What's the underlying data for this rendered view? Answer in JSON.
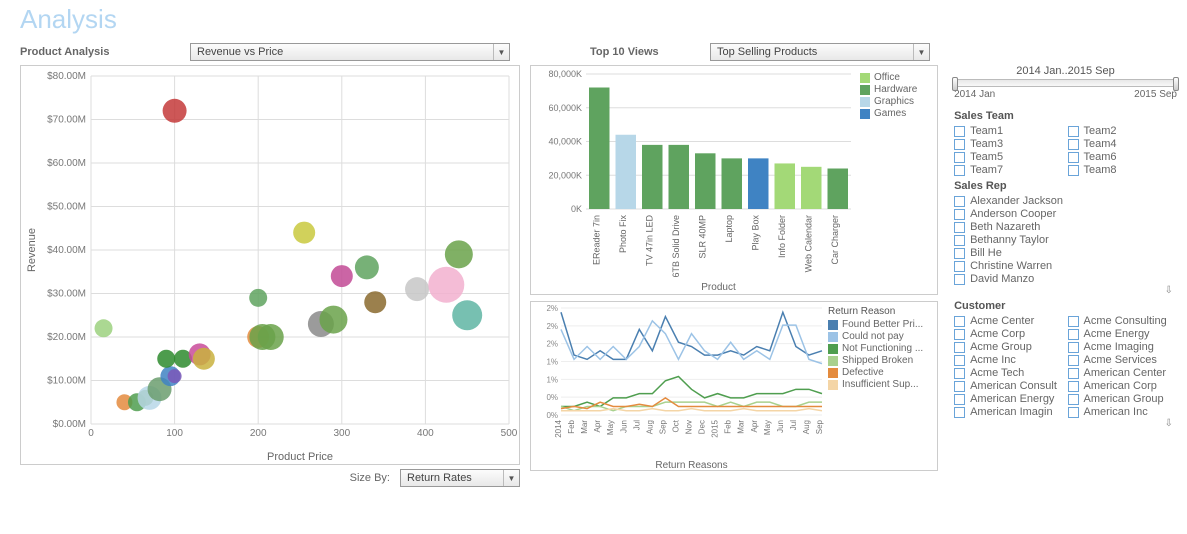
{
  "title": "Analysis",
  "productAnalysis": {
    "label": "Product Analysis",
    "dropdown": "Revenue vs Price"
  },
  "top10": {
    "label": "Top 10 Views",
    "dropdown": "Top Selling Products"
  },
  "sizeBy": {
    "label": "Size By:",
    "dropdown": "Return Rates"
  },
  "timeSlider": {
    "range": "2014 Jan..2015 Sep",
    "start": "2014 Jan",
    "end": "2015 Sep"
  },
  "scatter": {
    "xlabel": "Product Price",
    "ylabel": "Revenue",
    "xticks": [
      0,
      100,
      200,
      300,
      400,
      500
    ],
    "yticks": [
      "$0.00M",
      "$10.00M",
      "$20.00M",
      "$30.00M",
      "$40.00M",
      "$50.00M",
      "$60.00M",
      "$70.00M",
      "$80.00M"
    ]
  },
  "barChart": {
    "xlabel": "Product",
    "yticks": [
      "0K",
      "20,000K",
      "40,000K",
      "60,000K",
      "80,000K"
    ],
    "legend": [
      "Office",
      "Hardware",
      "Graphics",
      "Games"
    ],
    "categories": [
      "EReader 7in",
      "Photo Fix",
      "TV 47in LED",
      "6TB Solid Drive",
      "SLR 40MP",
      "Laptop",
      "Play Box",
      "Info Folder",
      "Web Calendar",
      "Car Charger"
    ]
  },
  "lineChart": {
    "title": "Return Reasons",
    "legendTitle": "Return Reason",
    "legend": [
      "Found Better Pri...",
      "Could not pay",
      "Not Functioning ...",
      "Shipped Broken",
      "Defective",
      "Insufficient Sup..."
    ],
    "xticks": [
      "2014",
      "Feb",
      "Mar",
      "Apr",
      "May",
      "Jun",
      "Jul",
      "Aug",
      "Sep",
      "Oct",
      "Nov",
      "Dec",
      "2015",
      "Feb",
      "Mar",
      "Apr",
      "May",
      "Jun",
      "Jul",
      "Aug",
      "Sep"
    ],
    "yticks": [
      "0%",
      "0%",
      "1%",
      "1%",
      "2%",
      "2%",
      "2%"
    ]
  },
  "filters": {
    "salesTeam": {
      "head": "Sales Team",
      "items": [
        "Team1",
        "Team2",
        "Team3",
        "Team4",
        "Team5",
        "Team6",
        "Team7",
        "Team8"
      ]
    },
    "salesRep": {
      "head": "Sales Rep",
      "items": [
        "Alexander Jackson",
        "Anderson Cooper",
        "Beth Nazareth",
        "Bethanny Taylor",
        "Bill He",
        "Christine Warren",
        "David Manzo"
      ]
    },
    "customer": {
      "head": "Customer",
      "items": [
        "Acme Center",
        "Acme Consulting",
        "Acme Corp",
        "Acme Energy",
        "Acme Group",
        "Acme Imaging",
        "Acme Inc",
        "Acme Services",
        "Acme Tech",
        "American Center",
        "American Consult",
        "American Corp",
        "American Energy",
        "American Group",
        "American Imagin",
        "American Inc"
      ]
    }
  },
  "chart_data": [
    {
      "type": "scatter",
      "title": "Revenue vs Price",
      "xlabel": "Product Price",
      "ylabel": "Revenue",
      "xlim": [
        0,
        500
      ],
      "ylim": [
        0,
        80
      ],
      "points": [
        {
          "x": 40,
          "y": 5,
          "r": 8,
          "color": "#e48b3e"
        },
        {
          "x": 55,
          "y": 5,
          "r": 9,
          "color": "#4f9e4f"
        },
        {
          "x": 65,
          "y": 6,
          "r": 8,
          "color": "#6aa24a"
        },
        {
          "x": 70,
          "y": 6,
          "r": 12,
          "color": "#b7d7e8"
        },
        {
          "x": 82,
          "y": 8,
          "r": 12,
          "color": "#6b9e6e"
        },
        {
          "x": 95,
          "y": 11,
          "r": 10,
          "color": "#3f83c3"
        },
        {
          "x": 100,
          "y": 11,
          "r": 7,
          "color": "#7a58b8"
        },
        {
          "x": 100,
          "y": 72,
          "r": 12,
          "color": "#c43a3a"
        },
        {
          "x": 15,
          "y": 22,
          "r": 9,
          "color": "#9cd17f"
        },
        {
          "x": 90,
          "y": 15,
          "r": 9,
          "color": "#2e8b2e"
        },
        {
          "x": 110,
          "y": 15,
          "r": 9,
          "color": "#2e8b2e"
        },
        {
          "x": 130,
          "y": 16,
          "r": 11,
          "color": "#c94b9a"
        },
        {
          "x": 135,
          "y": 15,
          "r": 11,
          "color": "#c9b23e"
        },
        {
          "x": 200,
          "y": 20,
          "r": 11,
          "color": "#e48b3e"
        },
        {
          "x": 215,
          "y": 20,
          "r": 13,
          "color": "#6aa24a"
        },
        {
          "x": 200,
          "y": 29,
          "r": 9,
          "color": "#5fa35f"
        },
        {
          "x": 205,
          "y": 20,
          "r": 13,
          "color": "#6aa24a"
        },
        {
          "x": 255,
          "y": 44,
          "r": 11,
          "color": "#c9c93e"
        },
        {
          "x": 275,
          "y": 23,
          "r": 13,
          "color": "#8a8a8a"
        },
        {
          "x": 290,
          "y": 24,
          "r": 14,
          "color": "#6aa24a"
        },
        {
          "x": 300,
          "y": 34,
          "r": 11,
          "color": "#c24a95"
        },
        {
          "x": 330,
          "y": 36,
          "r": 12,
          "color": "#5fa35f"
        },
        {
          "x": 340,
          "y": 28,
          "r": 11,
          "color": "#8a6a2e"
        },
        {
          "x": 390,
          "y": 31,
          "r": 12,
          "color": "#c7c7c7"
        },
        {
          "x": 425,
          "y": 32,
          "r": 18,
          "color": "#f2b0cf"
        },
        {
          "x": 440,
          "y": 39,
          "r": 14,
          "color": "#6aa24a"
        },
        {
          "x": 450,
          "y": 25,
          "r": 15,
          "color": "#5fb5a3"
        }
      ]
    },
    {
      "type": "bar",
      "title": "Top Selling Products",
      "xlabel": "Product",
      "ylabel": "",
      "ylim": [
        0,
        80000
      ],
      "categories": [
        "EReader 7in",
        "Photo Fix",
        "TV 47in LED",
        "6TB Solid Drive",
        "SLR 40MP",
        "Laptop",
        "Play Box",
        "Info Folder",
        "Web Calendar",
        "Car Charger"
      ],
      "values": [
        72000,
        44000,
        38000,
        38000,
        33000,
        30000,
        30000,
        27000,
        25000,
        24000
      ],
      "series_cat": [
        "Hardware",
        "Graphics",
        "Hardware",
        "Hardware",
        "Hardware",
        "Hardware",
        "Games",
        "Office",
        "Office",
        "Hardware"
      ]
    },
    {
      "type": "line",
      "title": "Return Reasons",
      "xlabel": "",
      "ylabel": "",
      "ylim": [
        0,
        2.5
      ],
      "x": [
        "2014-01",
        "2014-02",
        "2014-03",
        "2014-04",
        "2014-05",
        "2014-06",
        "2014-07",
        "2014-08",
        "2014-09",
        "2014-10",
        "2014-11",
        "2014-12",
        "2015-01",
        "2015-02",
        "2015-03",
        "2015-04",
        "2015-05",
        "2015-06",
        "2015-07",
        "2015-08",
        "2015-09"
      ],
      "series": [
        {
          "name": "Found Better Price",
          "color": "#4a7fb0",
          "values": [
            2.4,
            1.4,
            1.3,
            1.5,
            1.3,
            1.3,
            2.0,
            1.5,
            2.3,
            1.7,
            1.6,
            1.4,
            1.4,
            1.5,
            1.4,
            1.6,
            1.5,
            2.4,
            1.6,
            1.4,
            1.5
          ]
        },
        {
          "name": "Could not pay",
          "color": "#9cc3e6",
          "values": [
            2.0,
            1.3,
            1.6,
            1.3,
            1.6,
            1.3,
            1.6,
            2.2,
            1.9,
            1.3,
            1.9,
            1.5,
            1.3,
            1.7,
            1.3,
            1.5,
            1.3,
            2.1,
            2.1,
            1.3,
            1.2
          ]
        },
        {
          "name": "Not Functioning",
          "color": "#4f9e4f",
          "values": [
            0.2,
            0.2,
            0.3,
            0.2,
            0.4,
            0.4,
            0.5,
            0.5,
            0.8,
            0.9,
            0.6,
            0.4,
            0.5,
            0.4,
            0.4,
            0.5,
            0.5,
            0.5,
            0.6,
            0.6,
            0.5
          ]
        },
        {
          "name": "Shipped Broken",
          "color": "#a9d18e",
          "values": [
            0.2,
            0.1,
            0.2,
            0.2,
            0.1,
            0.2,
            0.2,
            0.2,
            0.3,
            0.3,
            0.3,
            0.3,
            0.2,
            0.3,
            0.2,
            0.3,
            0.3,
            0.2,
            0.2,
            0.3,
            0.3
          ]
        },
        {
          "name": "Defective",
          "color": "#e48b3e",
          "values": [
            0.15,
            0.2,
            0.15,
            0.3,
            0.2,
            0.2,
            0.25,
            0.2,
            0.4,
            0.2,
            0.2,
            0.2,
            0.2,
            0.2,
            0.2,
            0.2,
            0.2,
            0.2,
            0.2,
            0.2,
            0.2
          ]
        },
        {
          "name": "Insufficient Supply",
          "color": "#f4d5a6",
          "values": [
            0.1,
            0.1,
            0.1,
            0.1,
            0.15,
            0.1,
            0.1,
            0.15,
            0.1,
            0.1,
            0.15,
            0.1,
            0.1,
            0.1,
            0.15,
            0.1,
            0.1,
            0.1,
            0.1,
            0.15,
            0.1
          ]
        }
      ]
    }
  ]
}
